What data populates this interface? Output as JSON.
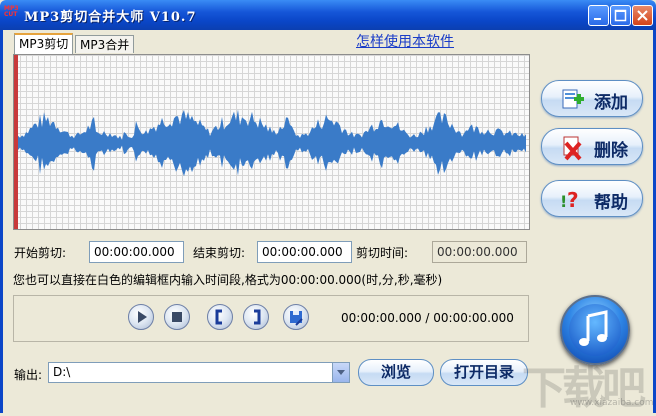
{
  "window": {
    "title": "MP3剪切合并大师 V10.7",
    "app_icon": "music-app-icon"
  },
  "tabs": [
    {
      "label": "MP3剪切",
      "active": true
    },
    {
      "label": "MP3合并",
      "active": false
    }
  ],
  "help_link": "怎样使用本软件",
  "side_buttons": {
    "add": "添加",
    "delete": "删除",
    "help": "帮助"
  },
  "cut": {
    "start_label": "开始剪切:",
    "start_value": "00:00:00.000",
    "end_label": "结束剪切:",
    "end_value": "00:00:00.000",
    "duration_label": "剪切时间:",
    "duration_value": "00:00:00.000",
    "hint": "您也可以直接在白色的编辑框内输入时间段,格式为00:00:00.000(时,分,秒,毫秒)"
  },
  "player": {
    "time": "00:00:00.000 / 00:00:00.000"
  },
  "output": {
    "label": "输出:",
    "value": "D:\\",
    "browse": "浏览",
    "open_dir": "打开目录"
  },
  "watermark": {
    "text": "下载吧",
    "sub": "www.xiazaiba.com"
  },
  "colors": {
    "title_bar": "#0b46c8",
    "waveform": "#3a7bc8",
    "marker": "#c83a3a"
  }
}
